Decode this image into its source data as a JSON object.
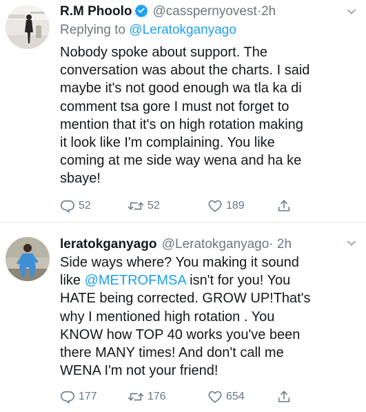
{
  "tweets": [
    {
      "display_name": "R.M Phoolo",
      "verified": true,
      "handle": "@casspernyovest",
      "dot": "·",
      "time": "2h",
      "replying_prefix": "Replying to",
      "replying_to": "@Leratokganyago",
      "lines": [
        "Nobody spoke about support. The",
        "conversation was about the charts. I said",
        "maybe it's not good enough wa tla ka di",
        "comment tsa gore I must not forget to",
        "mention that it's on high rotation making",
        "it look like I'm complaining. You like",
        "coming at me side way wena and ha ke",
        "sbaye!"
      ],
      "replies": "52",
      "retweets": "52",
      "likes": "189"
    },
    {
      "display_name": "leratokganyago",
      "verified": false,
      "handle": "@Leratokganyago",
      "dot": "·",
      "time": "2h",
      "lines_rich": [
        [
          {
            "t": "Side ways where? You making it sound",
            "link": false
          }
        ],
        [
          {
            "t": "like ",
            "link": false
          },
          {
            "t": "@METROFMSA",
            "link": true
          },
          {
            "t": " isn't for you! You",
            "link": false
          }
        ],
        [
          {
            "t": "HATE being corrected. GROW UP!That's",
            "link": false
          }
        ],
        [
          {
            "t": "why I mentioned high rotation . You",
            "link": false
          }
        ],
        [
          {
            "t": "KNOW how TOP 40 works you've been",
            "link": false
          }
        ],
        [
          {
            "t": "there MANY times! And don't call me",
            "link": false
          }
        ],
        [
          {
            "t": "WENA I'm not your friend!",
            "link": false
          }
        ]
      ],
      "replies": "177",
      "retweets": "176",
      "likes": "654"
    }
  ],
  "colors": {
    "text": "#14171a",
    "secondary": "#6e767d",
    "link": "#1da1f2",
    "verified": "#1da1f2",
    "action": "#657786",
    "separator": "#e6ecf0"
  },
  "icons": [
    "verified-badge-icon",
    "chevron-down-icon",
    "reply-icon",
    "retweet-icon",
    "like-icon",
    "share-icon"
  ]
}
